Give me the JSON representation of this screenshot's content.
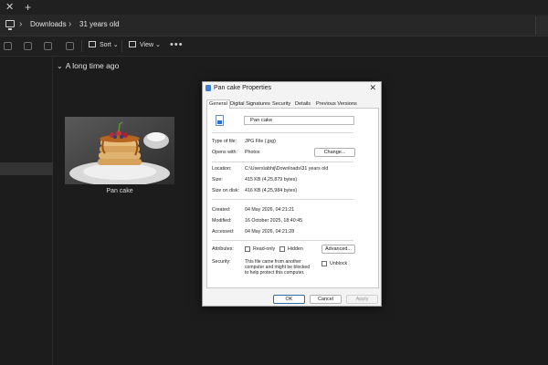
{
  "titlebar": {
    "close_glyph": "✕",
    "add_glyph": "+"
  },
  "address": {
    "crumbs": [
      "Downloads",
      "31 years old"
    ]
  },
  "toolbar": {
    "sort_label": "Sort",
    "view_label": "View",
    "more_glyph": "•••"
  },
  "main": {
    "group_header": "A long time ago",
    "item": {
      "name": "Pan cake"
    }
  },
  "dialog": {
    "title": "Pan cake Properties",
    "close_glyph": "✕",
    "tabs": [
      "General",
      "Digital Signatures",
      "Security",
      "Details",
      "Previous Versions"
    ],
    "active_tab": "General",
    "file_name": "Pan cake",
    "type_label": "Type of file:",
    "type_value": "JPG File (.jpg)",
    "opens_label": "Opens with:",
    "opens_value": "Photos",
    "change_button": "Change...",
    "location_label": "Location:",
    "location_value": "C:\\Users\\abhij\\Downloads\\31 years old",
    "size_label": "Size:",
    "size_value": "415 KB (4,25,879 bytes)",
    "size_on_disk_label": "Size on disk:",
    "size_on_disk_value": "416 KB (4,25,984 bytes)",
    "created_label": "Created:",
    "created_value": "04 May 2026, 04:21:21",
    "modified_label": "Modified:",
    "modified_value": "16 October 2025, 18:40:45",
    "accessed_label": "Accessed:",
    "accessed_value": "04 May 2026, 04:21:28",
    "attributes_label": "Attributes:",
    "readonly_label": "Read-only",
    "hidden_label": "Hidden",
    "advanced_button": "Advanced...",
    "security_label": "Security:",
    "security_text": "This file came from another computer and might be blocked to help protect this computer.",
    "unblock_label": "Unblock",
    "ok_button": "OK",
    "cancel_button": "Cancel",
    "apply_button": "Apply"
  },
  "colors": {
    "background": "#1c1c1c",
    "dialog": "#f3f3f3",
    "accent": "#2b6cb0"
  }
}
